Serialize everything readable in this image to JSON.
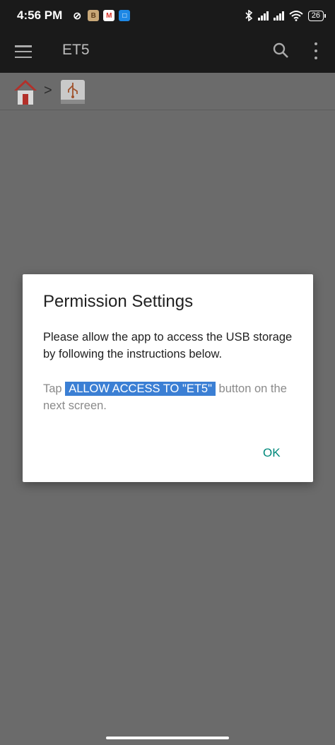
{
  "status_bar": {
    "time": "4:56 PM",
    "mute_icon": "⊘",
    "notif_a": "B",
    "notif_m": "M",
    "notif_b": "□",
    "battery": "26"
  },
  "app_bar": {
    "title": "ET5"
  },
  "breadcrumb": {
    "separator": ">"
  },
  "dialog": {
    "title": "Permission Settings",
    "message": "Please allow the app to access the USB storage by following the instructions below.",
    "instruction_prefix": "Tap ",
    "instruction_highlight": "ALLOW ACCESS TO \"ET5\"",
    "instruction_suffix": " button on the next screen.",
    "ok_label": "OK"
  },
  "colors": {
    "accent": "#00897b",
    "highlight": "#3b7fd4",
    "scrim": "#6b6b6b",
    "app_bar": "#1a1a1a"
  }
}
